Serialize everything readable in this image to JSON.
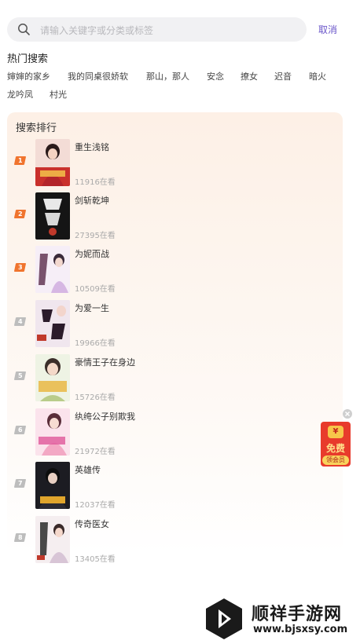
{
  "search": {
    "placeholder": "请输入关键字或分类或标签",
    "value": "",
    "cancel_label": "取消"
  },
  "hot": {
    "title": "热门搜索",
    "tags": [
      "婶婶的家乡",
      "我的同桌很娇软",
      "那山，那人",
      "安念",
      "撩女",
      "迟音",
      "暗火",
      "龙吟凤",
      "村光"
    ]
  },
  "ranking": {
    "title": "搜索排行",
    "items": [
      {
        "rank": "1",
        "title": "重生浅铭",
        "readers": "11916在看"
      },
      {
        "rank": "2",
        "title": "剑斩乾坤",
        "readers": "27395在看"
      },
      {
        "rank": "3",
        "title": "为妮而战",
        "readers": "10509在看"
      },
      {
        "rank": "4",
        "title": "为爱一生",
        "readers": "19966在看"
      },
      {
        "rank": "5",
        "title": "豪情王子在身边",
        "readers": "15726在看"
      },
      {
        "rank": "6",
        "title": "纨绔公子别欺我",
        "readers": "21972在看"
      },
      {
        "rank": "7",
        "title": "英雄传",
        "readers": "12037在看"
      },
      {
        "rank": "8",
        "title": "传奇医女",
        "readers": "13405在看"
      }
    ]
  },
  "ad": {
    "free_label": "免费",
    "vip_label": "领会员",
    "coin_label": "¥"
  },
  "watermark": {
    "name": "顺祥手游网",
    "url": "www.bjsxsy.com"
  },
  "colors": {
    "accent": "#6a55c9",
    "rank_top": "#f0742e",
    "rank_rest": "#bdbdbd",
    "panel": "#fdf0e6"
  }
}
